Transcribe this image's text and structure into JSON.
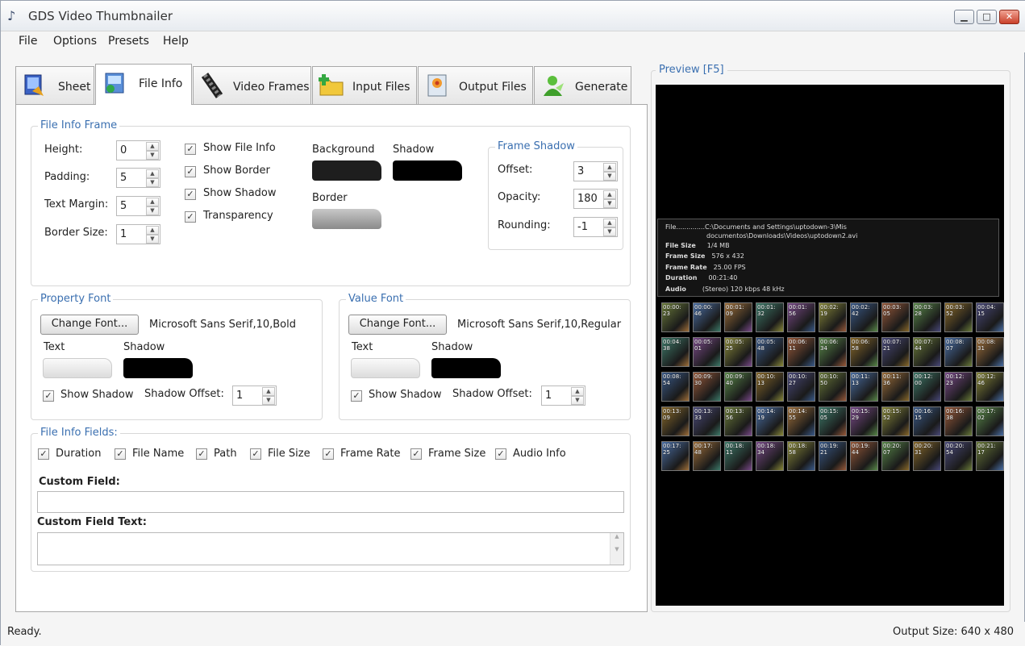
{
  "window": {
    "title": "GDS Video Thumbnailer"
  },
  "menu": [
    "File",
    "Options",
    "Presets",
    "Help"
  ],
  "tabs": [
    {
      "label": "Sheet",
      "icon": "sheet-icon"
    },
    {
      "label": "File Info",
      "icon": "file-info-icon",
      "active": true
    },
    {
      "label": "Video Frames",
      "icon": "film-reel-icon"
    },
    {
      "label": "Input Files",
      "icon": "folder-add-icon"
    },
    {
      "label": "Output Files",
      "icon": "picture-file-icon"
    },
    {
      "label": "Generate",
      "icon": "generate-user-icon"
    }
  ],
  "file_info_frame": {
    "title": "File Info Frame",
    "height": {
      "label": "Height:",
      "value": "0"
    },
    "padding": {
      "label": "Padding:",
      "value": "5"
    },
    "text_margin": {
      "label": "Text Margin:",
      "value": "5"
    },
    "border_size": {
      "label": "Border Size:",
      "value": "1"
    },
    "show_file_info": "Show File Info",
    "show_border": "Show Border",
    "show_shadow": "Show Shadow",
    "transparency": "Transparency",
    "background_label": "Background",
    "shadow_label": "Shadow",
    "border_label": "Border",
    "colors": {
      "background": "#1e1e1e",
      "shadow": "#000000",
      "border": "#a0a0a0"
    }
  },
  "frame_shadow": {
    "title": "Frame Shadow",
    "offset": {
      "label": "Offset:",
      "value": "3"
    },
    "opacity": {
      "label": "Opacity:",
      "value": "180"
    },
    "rounding": {
      "label": "Rounding:",
      "value": "-1"
    }
  },
  "property_font": {
    "title": "Property Font",
    "button": "Change Font...",
    "font_desc": "Microsoft Sans Serif,10,Bold",
    "text_label": "Text",
    "shadow_label": "Shadow",
    "show_shadow": "Show Shadow",
    "shadow_offset_label": "Shadow Offset:",
    "shadow_offset": "1"
  },
  "value_font": {
    "title": "Value Font",
    "button": "Change Font...",
    "font_desc": "Microsoft Sans Serif,10,Regular",
    "text_label": "Text",
    "shadow_label": "Shadow",
    "show_shadow": "Show Shadow",
    "shadow_offset_label": "Shadow Offset:",
    "shadow_offset": "1"
  },
  "file_info_fields": {
    "title": "File Info Fields:",
    "fields": [
      "Duration",
      "File Name",
      "Path",
      "File Size",
      "Frame Rate",
      "Frame Size",
      "Audio Info"
    ],
    "custom_field_label": "Custom Field:",
    "custom_field_value": "",
    "custom_field_text_label": "Custom Field Text:",
    "custom_field_text_value": ""
  },
  "preview": {
    "title": "Preview  [F5]",
    "info_lines": [
      {
        "key": "File..............",
        "value": "C:\\Documents and Settings\\uptodown-3\\Mis"
      },
      {
        "key": "",
        "value": "documentos\\Downloads\\Videos\\uptodown2.avi"
      },
      {
        "key": "File Size",
        "value": "1/4 MB"
      },
      {
        "key": "Frame Size",
        "value": "576 x 432"
      },
      {
        "key": "Frame Rate",
        "value": "25.00 FPS"
      },
      {
        "key": "Duration",
        "value": "00:21:40"
      },
      {
        "key": "Audio",
        "value": "(Stereo) 120 kbps  48 kHz"
      }
    ],
    "thumb_times": [
      [
        "00:00:23",
        "00:00:46",
        "00:01:09",
        "00:01:32",
        "00:01:56",
        "00:02:19",
        "00:02:42",
        "00:03:05",
        "00:03:28",
        "00:03:52",
        "00:04:15"
      ],
      [
        "00:04:38",
        "00:05:01",
        "00:05:25",
        "00:05:48",
        "00:06:11",
        "00:06:34",
        "00:06:58",
        "00:07:21",
        "00:07:44",
        "00:08:07",
        "00:08:31"
      ],
      [
        "00:08:54",
        "00:09:30",
        "00:09:40",
        "00:10:13",
        "00:10:27",
        "00:10:50",
        "00:11:13",
        "00:11:36",
        "00:12:00",
        "00:12:23",
        "00:12:46"
      ],
      [
        "00:13:09",
        "00:13:33",
        "00:13:56",
        "00:14:19",
        "00:14:55",
        "00:15:05",
        "00:15:29",
        "00:15:52",
        "00:16:15",
        "00:16:38",
        "00:17:02"
      ],
      [
        "00:17:25",
        "00:17:48",
        "00:18:11",
        "00:18:34",
        "00:18:58",
        "00:19:21",
        "00:19:44",
        "00:20:07",
        "00:20:31",
        "00:20:54",
        "00:21:17"
      ]
    ]
  },
  "status": {
    "left": "Ready.",
    "right": "Output Size: 640 x 480"
  }
}
